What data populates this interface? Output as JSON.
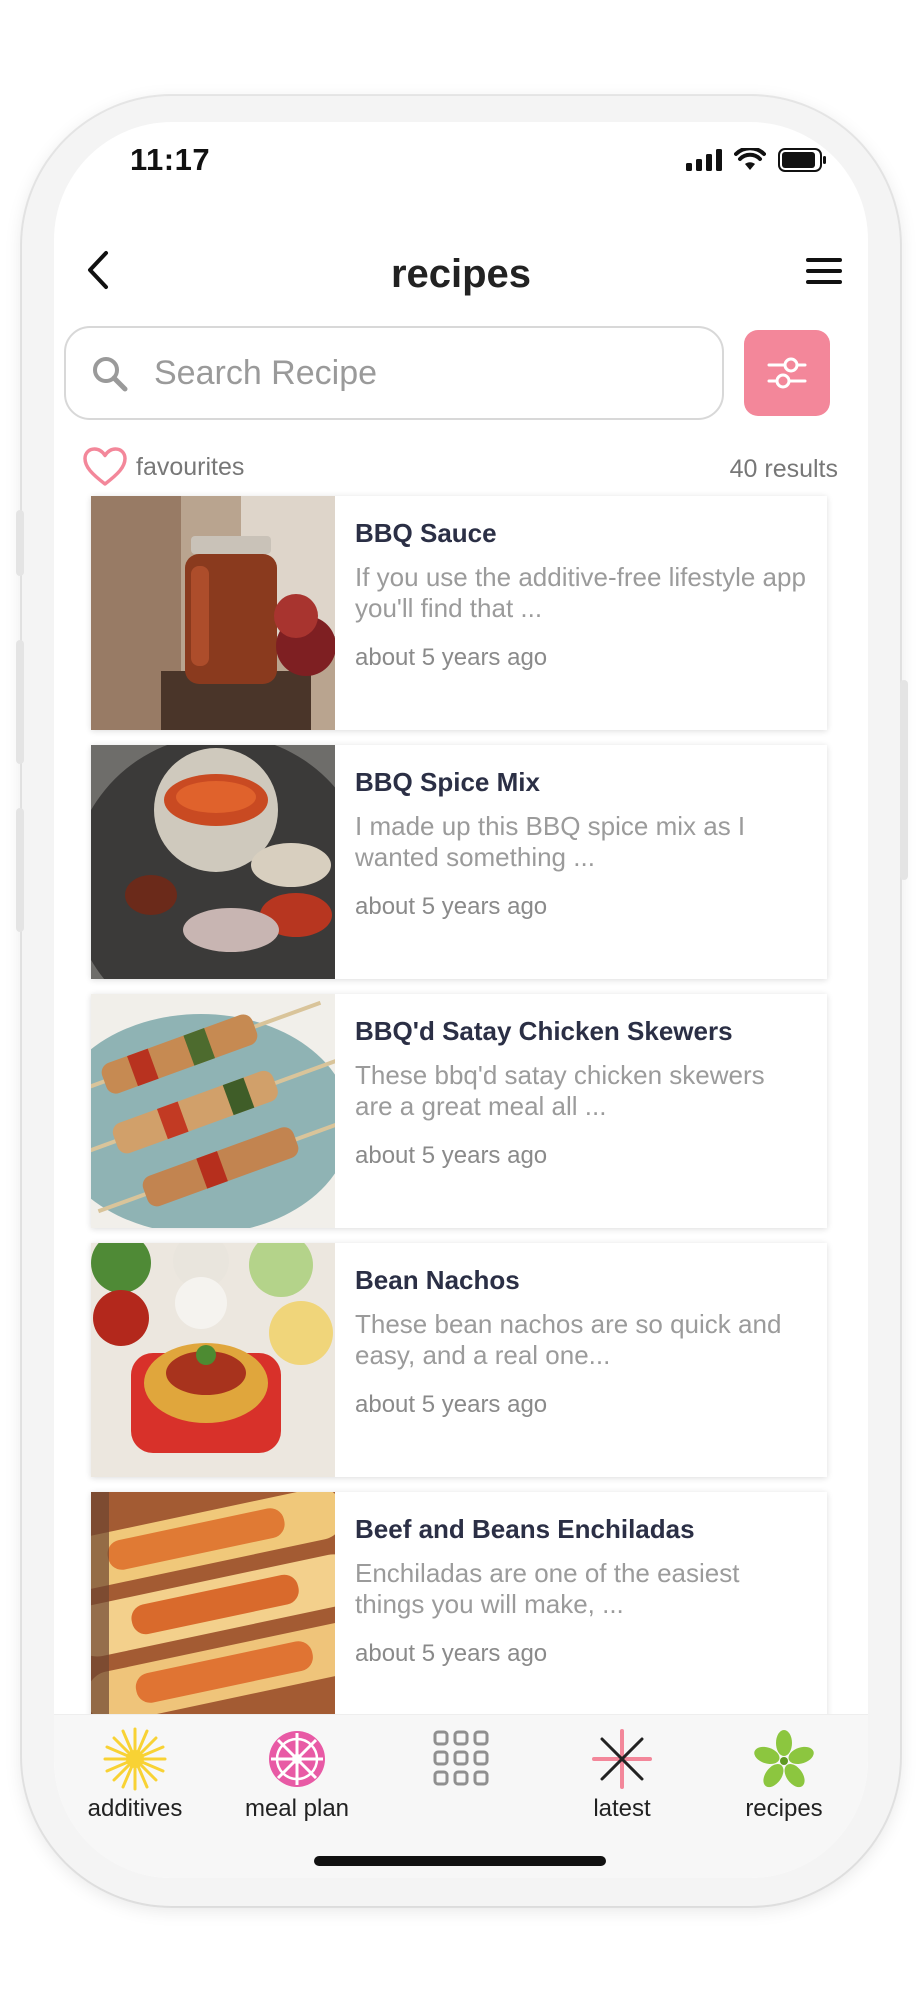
{
  "status_bar": {
    "time": "11:17"
  },
  "header": {
    "title": "recipes"
  },
  "search": {
    "placeholder": "Search Recipe"
  },
  "favourites": {
    "label": "favourites"
  },
  "results": {
    "count_label": "40 results"
  },
  "recipes": [
    {
      "title": "BBQ Sauce",
      "description": "If you use the additive-free lifestyle app you'll find that ...",
      "date": "about 5 years ago"
    },
    {
      "title": "BBQ Spice Mix",
      "description": "I made up this BBQ spice mix as I wanted something ...",
      "date": "about 5 years ago"
    },
    {
      "title": "BBQ'd Satay Chicken Skewers",
      "description": "These bbq'd satay chicken skewers are a great meal all ...",
      "date": "about 5 years ago"
    },
    {
      "title": "Bean Nachos",
      "description": "These bean nachos are so quick and easy, and a real one...",
      "date": "about 5 years ago"
    },
    {
      "title": "Beef and Beans Enchiladas",
      "description": "Enchiladas are one of the easiest things you will make, ...",
      "date": "about 5 years ago"
    }
  ],
  "tab_bar": {
    "items": [
      {
        "label": "additives",
        "icon": "sun-icon"
      },
      {
        "label": "meal plan",
        "icon": "plate-icon"
      },
      {
        "label": "",
        "icon": "grid-icon"
      },
      {
        "label": "latest",
        "icon": "sparkle-icon"
      },
      {
        "label": "recipes",
        "icon": "leaf-icon"
      }
    ]
  },
  "colors": {
    "accent_pink": "#f3879a",
    "title_navy": "#2b2f45",
    "additives_yellow": "#f8d234",
    "recipes_green": "#8cc63f"
  }
}
